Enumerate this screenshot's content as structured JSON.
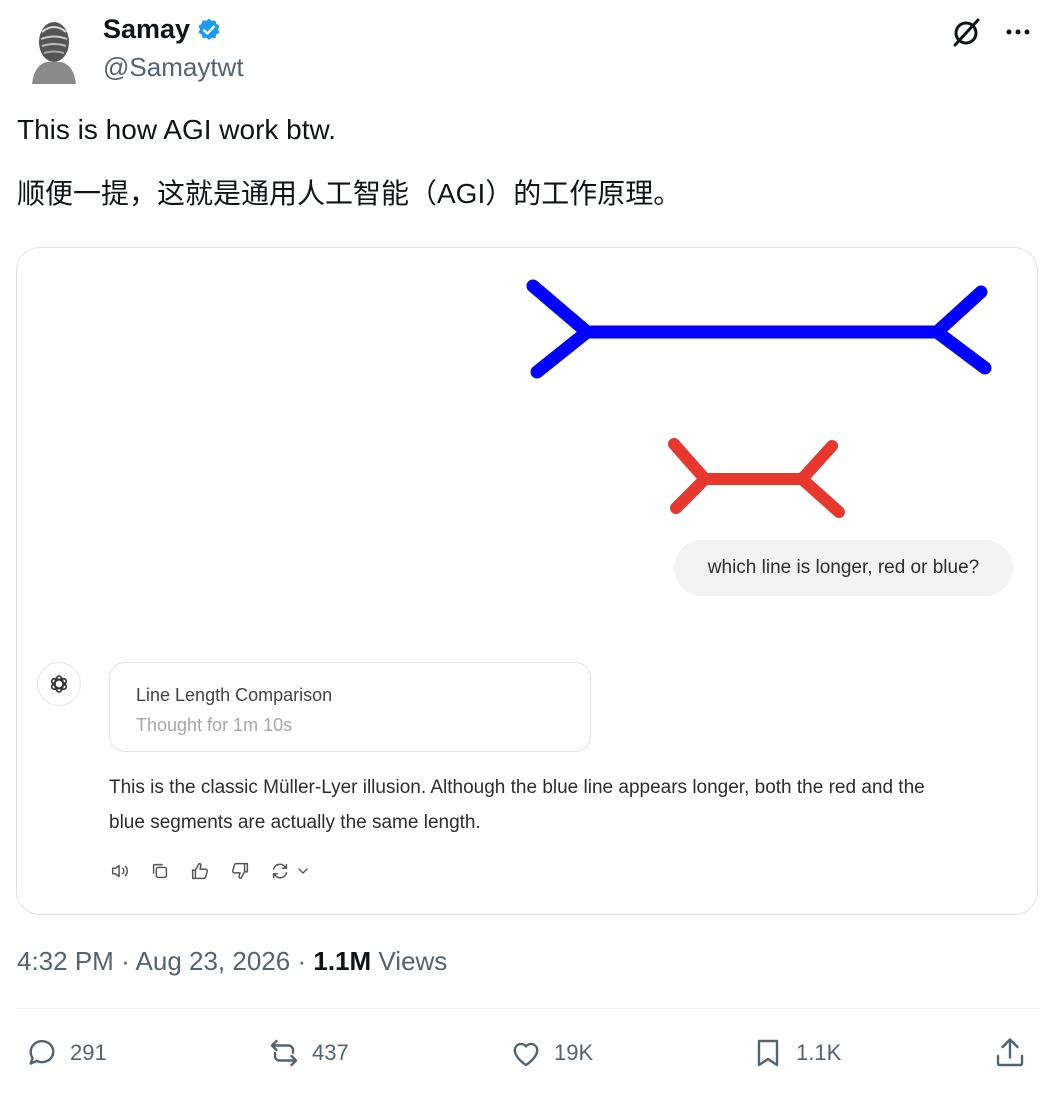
{
  "author": {
    "name": "Samay",
    "handle": "@Samaytwt"
  },
  "tweet": {
    "line1": "This is how AGI work btw.",
    "line2": "顺便一提，这就是通用人工智能（AGI）的工作原理。"
  },
  "media": {
    "user_question": "which line is longer, red or blue?",
    "thought_title": "Line Length Comparison",
    "thought_duration": "Thought for 1m 10s",
    "answer_line1": "This is the classic Müller-Lyer illusion. Although the blue line appears longer, both the red and the",
    "answer_line2": "blue segments are actually the same length.",
    "colors": {
      "blue_line": "#0000ff",
      "red_line": "#e8382e"
    }
  },
  "meta": {
    "time": "4:32 PM",
    "date": "Aug 23, 2026",
    "views_count": "1.1M",
    "views_label": "Views",
    "separator": "·"
  },
  "engagement": {
    "replies": "291",
    "reposts": "437",
    "likes": "19K",
    "bookmarks": "1.1K"
  }
}
